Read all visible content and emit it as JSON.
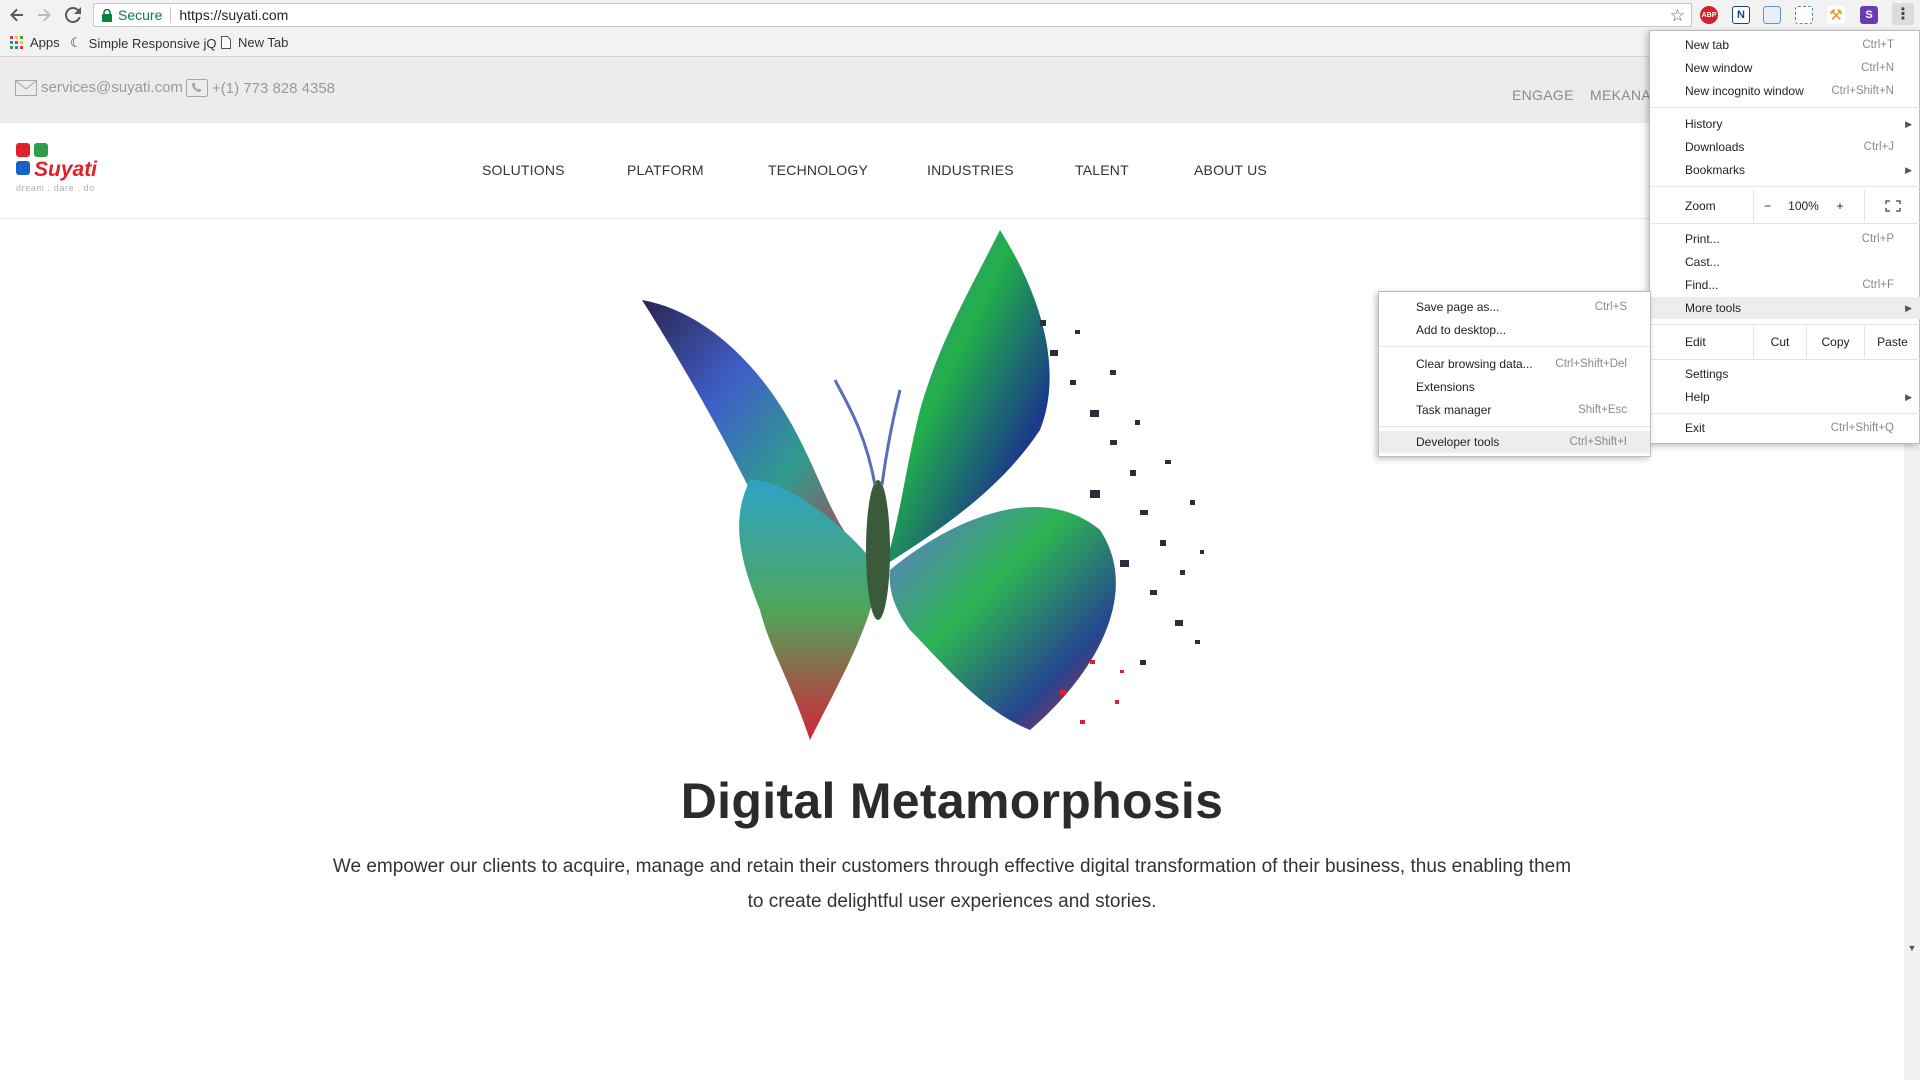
{
  "browser": {
    "secure_label": "Secure",
    "url": "https://suyati.com",
    "bookmarks": [
      {
        "label": "Apps"
      },
      {
        "label": "Simple Responsive jQ"
      },
      {
        "label": "New Tab"
      }
    ],
    "extensions": [
      "ABP",
      "N",
      "S"
    ]
  },
  "topbar": {
    "email": "services@suyati.com",
    "phone": "+(1) 773 828 4358",
    "links": [
      "ENGAGE",
      "MEKANA"
    ]
  },
  "logo": {
    "name": "Suyati",
    "tagline": "dream . dare . do"
  },
  "nav": [
    "SOLUTIONS",
    "PLATFORM",
    "TECHNOLOGY",
    "INDUSTRIES",
    "TALENT",
    "ABOUT US"
  ],
  "hero": {
    "title": "Digital Metamorphosis",
    "text": "We empower our clients to acquire, manage and retain their customers through effective digital transformation of their business, thus enabling them to create delightful user experiences and stories."
  },
  "chrome_menu": {
    "new_tab": {
      "label": "New tab",
      "shortcut": "Ctrl+T"
    },
    "new_window": {
      "label": "New window",
      "shortcut": "Ctrl+N"
    },
    "new_incognito": {
      "label": "New incognito window",
      "shortcut": "Ctrl+Shift+N"
    },
    "history": {
      "label": "History"
    },
    "downloads": {
      "label": "Downloads",
      "shortcut": "Ctrl+J"
    },
    "bookmarks": {
      "label": "Bookmarks"
    },
    "zoom": {
      "label": "Zoom",
      "minus": "−",
      "value": "100%",
      "plus": "+"
    },
    "print": {
      "label": "Print...",
      "shortcut": "Ctrl+P"
    },
    "cast": {
      "label": "Cast..."
    },
    "find": {
      "label": "Find...",
      "shortcut": "Ctrl+F"
    },
    "more_tools": {
      "label": "More tools"
    },
    "edit": {
      "label": "Edit",
      "cut": "Cut",
      "copy": "Copy",
      "paste": "Paste"
    },
    "settings": {
      "label": "Settings"
    },
    "help": {
      "label": "Help"
    },
    "exit": {
      "label": "Exit",
      "shortcut": "Ctrl+Shift+Q"
    }
  },
  "more_tools_menu": {
    "save_page": {
      "label": "Save page as...",
      "shortcut": "Ctrl+S"
    },
    "add_to_desktop": {
      "label": "Add to desktop..."
    },
    "clear_browsing": {
      "label": "Clear browsing data...",
      "shortcut": "Ctrl+Shift+Del"
    },
    "extensions": {
      "label": "Extensions"
    },
    "task_manager": {
      "label": "Task manager",
      "shortcut": "Shift+Esc"
    },
    "developer_tools": {
      "label": "Developer tools",
      "shortcut": "Ctrl+Shift+I"
    }
  },
  "colors": {
    "brand_red": "#e02127",
    "brand_green": "#2e9e48",
    "brand_blue": "#1a63c6",
    "secure_green": "#0b8043"
  }
}
